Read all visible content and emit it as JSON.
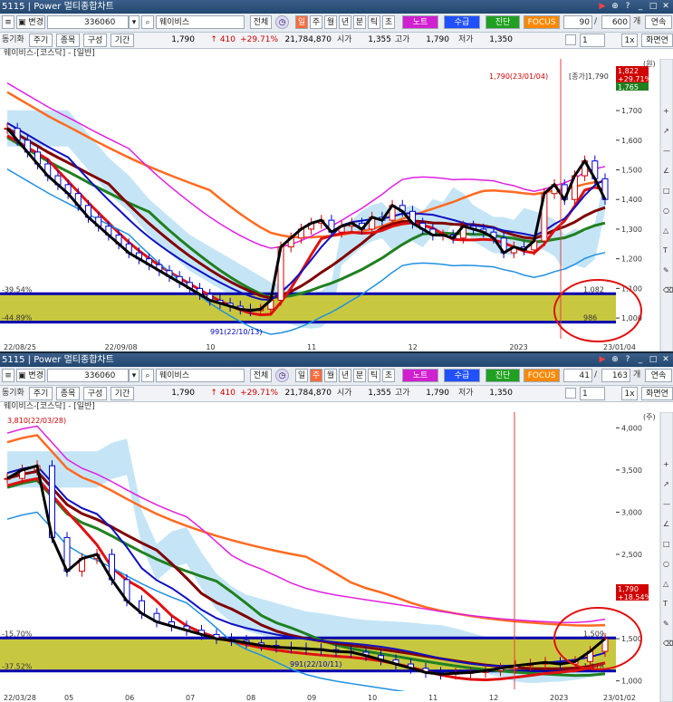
{
  "common": {
    "window_id": "5115",
    "window_title": "Power 멀티종합차트",
    "code": "336060",
    "name": "웨이비스",
    "btn_all": "전체",
    "period_buttons": [
      "일",
      "주",
      "월",
      "년",
      "분",
      "틱",
      "초"
    ],
    "btn_note": "노트",
    "btn_supply": "수급",
    "btn_diag": "진단",
    "btn_focus": "FOCUS",
    "unit": "개",
    "row2_left": "동기화",
    "row2_btns": [
      "주기",
      "종목",
      "구성",
      "기간"
    ],
    "price": "1,790",
    "change": "410",
    "change_pct": "+29.71%",
    "volume": "21,784,870",
    "open_label": "시가",
    "open_val": "1,355",
    "high_label": "고가",
    "high_val": "1,790",
    "low_label": "저가",
    "low_val": "1,350",
    "spin_val": "1",
    "scale_label": "1x",
    "chart_title": "웨이비스-[코스닥] - [일반]",
    "right_btns": [
      "연속",
      "화면연"
    ],
    "colors": {
      "up": "#d00000",
      "down": "#0000d0",
      "title": "#22476f",
      "band": "#c8c840",
      "note": "#e020e0",
      "supply": "#2050ff",
      "diag": "#20a020",
      "focus": "#ff8800"
    }
  },
  "top": {
    "active_period": "일",
    "count": "90",
    "total": "600",
    "unit_top": "(원)",
    "max_label": "1,790(23/01/04)",
    "last_tag": "[종가]1,790",
    "price_tags": [
      "1,822",
      "+29.71%",
      "1,765"
    ],
    "yaxis": [
      "1,700",
      "1,600",
      "1,500",
      "1,400",
      "1,300",
      "1,200",
      "1,100",
      "1,000"
    ],
    "left_pct_top": "-39.54%",
    "left_pct_bot": "-44.89%",
    "line_val_top": "1,082",
    "line_val_bot": "986",
    "min_label": "991(22/10/13)",
    "xaxis": [
      "22/08/25",
      "22/09/08",
      "10",
      "11",
      "12",
      "2023",
      "23/01/04"
    ],
    "chart_data": {
      "type": "line",
      "x_start": "22/08/25",
      "x_end": "23/01/04",
      "ylim": [
        930,
        1850
      ],
      "series": [
        {
          "values": [
            1640,
            1600,
            1560,
            1520,
            1480,
            1450,
            1420,
            1380,
            1340,
            1310,
            1280,
            1250,
            1220,
            1200,
            1180,
            1160,
            1140,
            1120,
            1100,
            1080,
            1060,
            1050,
            1040,
            1030,
            1025,
            1030,
            1060,
            1240,
            1270,
            1300,
            1320,
            1330,
            1290,
            1310,
            1320,
            1300,
            1340,
            1330,
            1380,
            1360,
            1320,
            1300,
            1280,
            1280,
            1270,
            1310,
            1300,
            1290,
            1270,
            1220,
            1240,
            1230,
            1260,
            1420,
            1450,
            1400,
            1480,
            1530,
            1470,
            1400
          ]
        }
      ]
    }
  },
  "bottom": {
    "active_period": "주",
    "count": "41",
    "total": "163",
    "unit_top": "(주)",
    "max_label": "3,810(22/03/28)",
    "price_tags": [
      "1,790",
      "+18.54%"
    ],
    "yaxis": [
      "4,000",
      "3,500",
      "3,000",
      "2,500",
      "2,000",
      "1,500",
      "1,000"
    ],
    "left_pct_top": "-15.70%",
    "left_pct_bot": "-37.52%",
    "line_val_top": "1,509",
    "line_val_bot": "1,118",
    "min_label": "991(22/10/11)",
    "xaxis": [
      "22/03/28",
      "05",
      "06",
      "07",
      "08",
      "09",
      "10",
      "11",
      "12",
      "2023",
      "23/01/02"
    ],
    "chart_data": {
      "type": "line",
      "x_start": "22/03/28",
      "x_end": "23/01/02",
      "ylim": [
        900,
        4100
      ],
      "series": [
        {
          "values": [
            3400,
            3500,
            3550,
            2700,
            2300,
            2450,
            2500,
            2200,
            1950,
            1800,
            1700,
            1650,
            1600,
            1550,
            1500,
            1480,
            1450,
            1420,
            1400,
            1390,
            1380,
            1370,
            1350,
            1340,
            1300,
            1250,
            1200,
            1150,
            1100,
            1080,
            1090,
            1100,
            1120,
            1150,
            1180,
            1200,
            1220,
            1200,
            1230,
            1350,
            1500
          ]
        }
      ]
    }
  }
}
